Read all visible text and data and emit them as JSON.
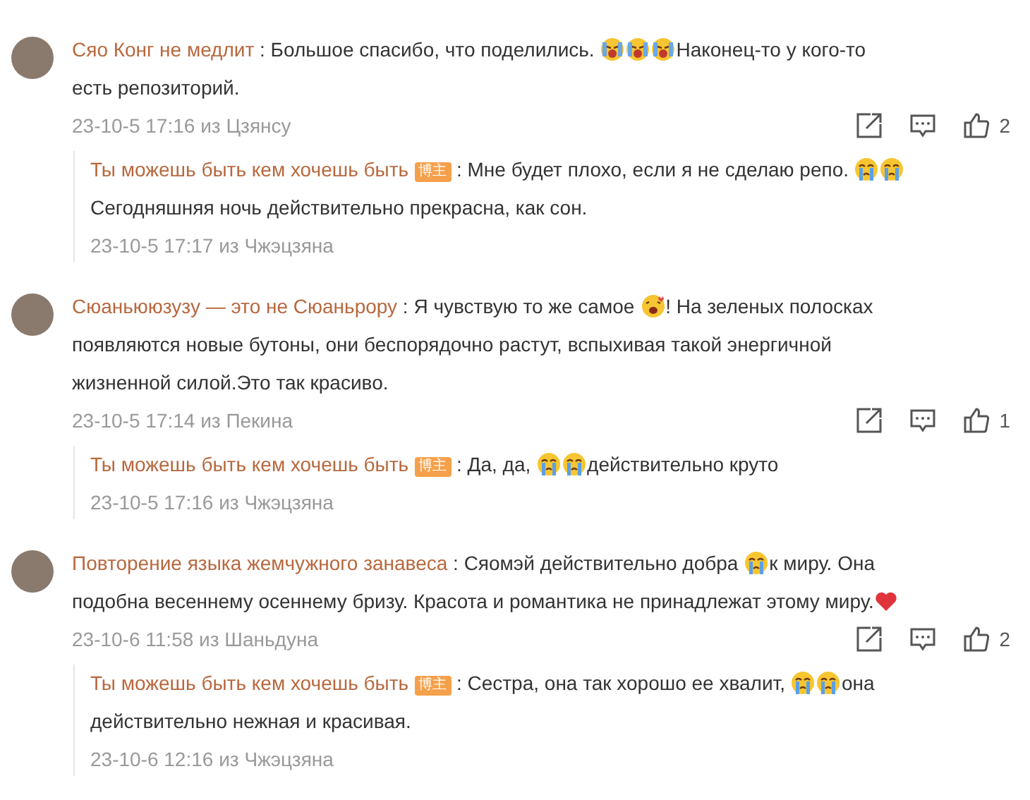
{
  "comments": [
    {
      "author": "Сяо Конг не медлит",
      "body": [
        {
          "kind": "text",
          "text": ": Большое спасибо, что поделились. "
        },
        {
          "kind": "shout"
        },
        {
          "kind": "shout"
        },
        {
          "kind": "shout"
        },
        {
          "kind": "text",
          "text": "Наконец-то у кого-то есть репозиторий."
        }
      ],
      "time": "23-10-5 17:16 из Цзянсу",
      "likes": "2",
      "replies": [
        {
          "author": "Ты можешь быть кем хочешь быть",
          "badge": "博主",
          "body": [
            {
              "kind": "text",
              "text": ": Мне будет плохо, если я не сделаю репо. "
            },
            {
              "kind": "sob"
            },
            {
              "kind": "sob"
            },
            {
              "kind": "text",
              "text": " Сегодняшняя ночь действительно прекрасна, как сон."
            }
          ],
          "time": "23-10-5 17:17 из Чжэцзяна"
        }
      ]
    },
    {
      "author": "Сюаньююзузу — это не Сюаньрору",
      "body": [
        {
          "kind": "text",
          "text": ": Я чувствую то же самое "
        },
        {
          "kind": "love"
        },
        {
          "kind": "text",
          "text": "! На зеленых полосках появляются новые бутоны, они беспорядочно растут, вспыхивая такой энергичной жизненной силой.Это так красиво."
        }
      ],
      "time": "23-10-5 17:14 из Пекина",
      "likes": "1",
      "replies": [
        {
          "author": "Ты можешь быть кем хочешь быть",
          "badge": "博主",
          "body": [
            {
              "kind": "text",
              "text": ": Да, да, "
            },
            {
              "kind": "sob"
            },
            {
              "kind": "sob"
            },
            {
              "kind": "text",
              "text": "действительно круто"
            }
          ],
          "time": "23-10-5 17:16 из Чжэцзяна"
        }
      ]
    },
    {
      "author": "Повторение языка жемчужного занавеса",
      "body": [
        {
          "kind": "text",
          "text": ": Сяомэй действительно добра "
        },
        {
          "kind": "sob"
        },
        {
          "kind": "text",
          "text": "к миру. Она подобна весеннему осеннему бризу. Красота и романтика не принадлежат этому миру."
        },
        {
          "kind": "heart"
        }
      ],
      "time": "23-10-6 11:58 из Шаньдуна",
      "likes": "2",
      "replies": [
        {
          "author": "Ты можешь быть кем хочешь быть",
          "badge": "博主",
          "body": [
            {
              "kind": "text",
              "text": ": Сестра, она так хорошо ее хвалит, "
            },
            {
              "kind": "sob"
            },
            {
              "kind": "sob"
            },
            {
              "kind": "text",
              "text": "она действительно нежная и красивая."
            }
          ],
          "time": "23-10-6 12:16 из Чжэцзяна"
        }
      ]
    }
  ]
}
